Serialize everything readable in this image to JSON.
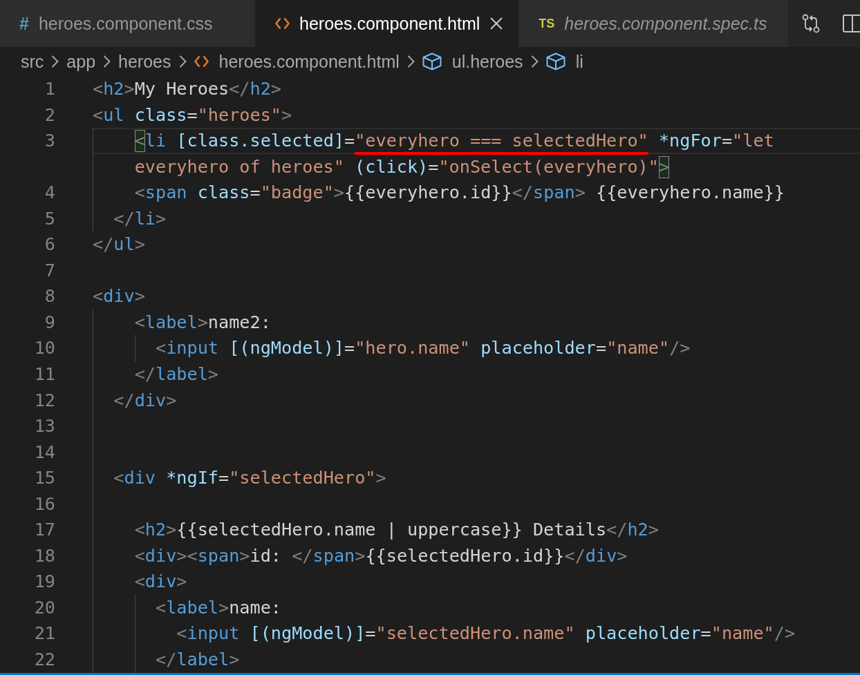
{
  "tabs": [
    {
      "kind": "css",
      "badge": "#",
      "label": "heroes.component.css",
      "selected": false,
      "preview": false
    },
    {
      "kind": "html",
      "label": "heroes.component.html",
      "selected": true,
      "preview": false
    },
    {
      "kind": "ts",
      "badge": "TS",
      "label": "heroes.component.spec.ts",
      "selected": false,
      "preview": true
    }
  ],
  "breadcrumbs": [
    {
      "kind": "folder",
      "label": "src"
    },
    {
      "kind": "folder",
      "label": "app"
    },
    {
      "kind": "folder",
      "label": "heroes"
    },
    {
      "kind": "file",
      "label": "heroes.component.html"
    },
    {
      "kind": "element",
      "label": "ul.heroes"
    },
    {
      "kind": "element",
      "label": "li"
    }
  ],
  "editor": {
    "lines": [
      {
        "number": "1",
        "current": false,
        "rows": [
          {
            "segments": [
              {
                "kind": "punct",
                "text": "<"
              },
              {
                "kind": "tag",
                "text": "h2"
              },
              {
                "kind": "punct",
                "text": ">"
              },
              {
                "kind": "text",
                "text": "My Heroes"
              },
              {
                "kind": "punct",
                "text": "</"
              },
              {
                "kind": "tag",
                "text": "h2"
              },
              {
                "kind": "punct",
                "text": ">"
              }
            ]
          }
        ]
      },
      {
        "number": "2",
        "current": false,
        "rows": [
          {
            "segments": [
              {
                "kind": "punct",
                "text": "<"
              },
              {
                "kind": "tag",
                "text": "ul"
              },
              {
                "kind": "attr",
                "text": " class"
              },
              {
                "kind": "op",
                "text": "="
              },
              {
                "kind": "string",
                "text": "\"heroes\""
              },
              {
                "kind": "punct",
                "text": ">"
              }
            ]
          }
        ]
      },
      {
        "number": "3",
        "current": true,
        "rows": [
          {
            "segments": [
              {
                "kind": "bracket",
                "text": "    <"
              },
              {
                "kind": "tag",
                "text": "li"
              },
              {
                "kind": "attr",
                "text": " [class.selected]"
              },
              {
                "kind": "op",
                "text": "="
              },
              {
                "kind": "marked-string",
                "text": "\"everyhero === selectedHero\""
              },
              {
                "kind": "attr",
                "text": " *ngFor"
              },
              {
                "kind": "op",
                "text": "="
              },
              {
                "kind": "string",
                "text": "\"let"
              }
            ]
          },
          {
            "segments": [
              {
                "kind": "string",
                "text": "everyhero of heroes\""
              },
              {
                "kind": "attr",
                "text": " (click)"
              },
              {
                "kind": "op",
                "text": "="
              },
              {
                "kind": "string",
                "text": "\"onSelect(everyhero)\""
              },
              {
                "kind": "bracket",
                "text": ">"
              }
            ]
          }
        ]
      },
      {
        "number": "4",
        "current": false,
        "rows": [
          {
            "segments": [
              {
                "kind": "punct",
                "text": "    <"
              },
              {
                "kind": "tag",
                "text": "span"
              },
              {
                "kind": "attr",
                "text": " class"
              },
              {
                "kind": "op",
                "text": "="
              },
              {
                "kind": "string",
                "text": "\"badge\""
              },
              {
                "kind": "punct",
                "text": ">"
              },
              {
                "kind": "text",
                "text": "{{everyhero.id}}"
              },
              {
                "kind": "punct",
                "text": "</"
              },
              {
                "kind": "tag",
                "text": "span"
              },
              {
                "kind": "punct",
                "text": ">"
              },
              {
                "kind": "text",
                "text": " {{everyhero.name}}"
              }
            ]
          }
        ]
      },
      {
        "number": "5",
        "current": false,
        "rows": [
          {
            "segments": [
              {
                "kind": "punct",
                "text": "  </"
              },
              {
                "kind": "tag",
                "text": "li"
              },
              {
                "kind": "punct",
                "text": ">"
              }
            ]
          }
        ]
      },
      {
        "number": "6",
        "current": false,
        "rows": [
          {
            "segments": [
              {
                "kind": "punct",
                "text": "</"
              },
              {
                "kind": "tag",
                "text": "ul"
              },
              {
                "kind": "punct",
                "text": ">"
              }
            ]
          }
        ]
      },
      {
        "number": "7",
        "current": false
      },
      {
        "number": "8",
        "current": false,
        "rows": [
          {
            "segments": [
              {
                "kind": "punct",
                "text": "<"
              },
              {
                "kind": "tag",
                "text": "div"
              },
              {
                "kind": "punct",
                "text": ">"
              }
            ]
          }
        ]
      },
      {
        "number": "9",
        "current": false,
        "rows": [
          {
            "segments": [
              {
                "kind": "punct",
                "text": "    <"
              },
              {
                "kind": "tag",
                "text": "label"
              },
              {
                "kind": "punct",
                "text": ">"
              },
              {
                "kind": "text",
                "text": "name2:"
              }
            ]
          }
        ]
      },
      {
        "number": "10",
        "current": false,
        "rows": [
          {
            "segments": [
              {
                "kind": "punct",
                "text": "      <"
              },
              {
                "kind": "tag",
                "text": "input"
              },
              {
                "kind": "attr",
                "text": " [(ngModel)]"
              },
              {
                "kind": "op",
                "text": "="
              },
              {
                "kind": "string",
                "text": "\"hero.name\""
              },
              {
                "kind": "attr",
                "text": " placeholder"
              },
              {
                "kind": "op",
                "text": "="
              },
              {
                "kind": "string",
                "text": "\"name\""
              },
              {
                "kind": "punct",
                "text": "/>"
              }
            ]
          }
        ]
      },
      {
        "number": "11",
        "current": false,
        "rows": [
          {
            "segments": [
              {
                "kind": "punct",
                "text": "    </"
              },
              {
                "kind": "tag",
                "text": "label"
              },
              {
                "kind": "punct",
                "text": ">"
              }
            ]
          }
        ]
      },
      {
        "number": "12",
        "current": false,
        "rows": [
          {
            "segments": [
              {
                "kind": "punct",
                "text": "  </"
              },
              {
                "kind": "tag",
                "text": "div"
              },
              {
                "kind": "punct",
                "text": ">"
              }
            ]
          }
        ]
      },
      {
        "number": "13",
        "current": false
      },
      {
        "number": "14",
        "current": false
      },
      {
        "number": "15",
        "current": false,
        "rows": [
          {
            "segments": [
              {
                "kind": "punct",
                "text": "  <"
              },
              {
                "kind": "tag",
                "text": "div"
              },
              {
                "kind": "attr",
                "text": " *ngIf"
              },
              {
                "kind": "op",
                "text": "="
              },
              {
                "kind": "string",
                "text": "\"selectedHero\""
              },
              {
                "kind": "punct",
                "text": ">"
              }
            ]
          }
        ]
      },
      {
        "number": "16",
        "current": false
      },
      {
        "number": "17",
        "current": false,
        "rows": [
          {
            "segments": [
              {
                "kind": "punct",
                "text": "    <"
              },
              {
                "kind": "tag",
                "text": "h2"
              },
              {
                "kind": "punct",
                "text": ">"
              },
              {
                "kind": "text",
                "text": "{{selectedHero.name | uppercase}} Details"
              },
              {
                "kind": "punct",
                "text": "</"
              },
              {
                "kind": "tag",
                "text": "h2"
              },
              {
                "kind": "punct",
                "text": ">"
              }
            ]
          }
        ]
      },
      {
        "number": "18",
        "current": false,
        "rows": [
          {
            "segments": [
              {
                "kind": "punct",
                "text": "    <"
              },
              {
                "kind": "tag",
                "text": "div"
              },
              {
                "kind": "punct",
                "text": "><"
              },
              {
                "kind": "tag",
                "text": "span"
              },
              {
                "kind": "punct",
                "text": ">"
              },
              {
                "kind": "text",
                "text": "id: "
              },
              {
                "kind": "punct",
                "text": "</"
              },
              {
                "kind": "tag",
                "text": "span"
              },
              {
                "kind": "punct",
                "text": ">"
              },
              {
                "kind": "text",
                "text": "{{selectedHero.id}}"
              },
              {
                "kind": "punct",
                "text": "</"
              },
              {
                "kind": "tag",
                "text": "div"
              },
              {
                "kind": "punct",
                "text": ">"
              }
            ]
          }
        ]
      },
      {
        "number": "19",
        "current": false,
        "rows": [
          {
            "segments": [
              {
                "kind": "punct",
                "text": "    <"
              },
              {
                "kind": "tag",
                "text": "div"
              },
              {
                "kind": "punct",
                "text": ">"
              }
            ]
          }
        ]
      },
      {
        "number": "20",
        "current": false,
        "rows": [
          {
            "segments": [
              {
                "kind": "punct",
                "text": "      <"
              },
              {
                "kind": "tag",
                "text": "label"
              },
              {
                "kind": "punct",
                "text": ">"
              },
              {
                "kind": "text",
                "text": "name:"
              }
            ]
          }
        ]
      },
      {
        "number": "21",
        "current": false,
        "rows": [
          {
            "segments": [
              {
                "kind": "punct",
                "text": "        <"
              },
              {
                "kind": "tag",
                "text": "input"
              },
              {
                "kind": "attr",
                "text": " [(ngModel)]"
              },
              {
                "kind": "op",
                "text": "="
              },
              {
                "kind": "string",
                "text": "\"selectedHero.name\""
              },
              {
                "kind": "attr",
                "text": " placeholder"
              },
              {
                "kind": "op",
                "text": "="
              },
              {
                "kind": "string",
                "text": "\"name\""
              },
              {
                "kind": "punct",
                "text": "/>"
              }
            ]
          }
        ]
      },
      {
        "number": "22",
        "current": false,
        "rows": [
          {
            "segments": [
              {
                "kind": "punct",
                "text": "      </"
              },
              {
                "kind": "tag",
                "text": "label"
              },
              {
                "kind": "punct",
                "text": ">"
              }
            ]
          }
        ]
      }
    ]
  }
}
